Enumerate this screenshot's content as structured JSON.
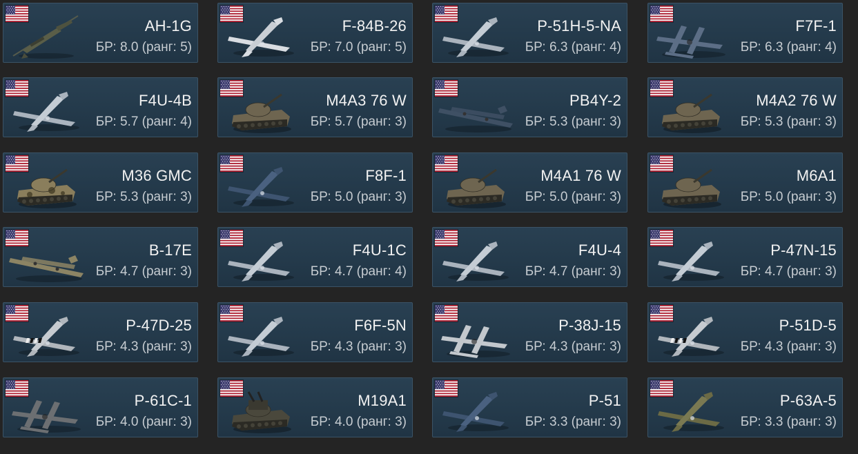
{
  "colors": {
    "background": "#242424",
    "card_bg": "#263d4e",
    "card_border": "#3b5366",
    "name_text": "#f2f2f2",
    "br_text": "#c6ccd1",
    "flag_red": "#b22234",
    "flag_blue": "#3c3b6e"
  },
  "vehicles": [
    {
      "name": "AH-1G",
      "br_line": "БР: 8.0 (ранг: 5)",
      "kind": "helicopter",
      "country": "USA",
      "flag_icon": "usa-flag-icon"
    },
    {
      "name": "F-84B-26",
      "br_line": "БР: 7.0 (ранг: 5)",
      "kind": "jet",
      "country": "USA",
      "flag_icon": "usa-flag-icon"
    },
    {
      "name": "P-51H-5-NA",
      "br_line": "БР: 6.3 (ранг: 4)",
      "kind": "plane",
      "country": "USA",
      "flag_icon": "usa-flag-icon"
    },
    {
      "name": "F7F-1",
      "br_line": "БР: 6.3 (ранг: 4)",
      "kind": "twin-plane-dark",
      "country": "USA",
      "flag_icon": "usa-flag-icon"
    },
    {
      "name": "F4U-4B",
      "br_line": "БР: 5.7 (ранг: 4)",
      "kind": "plane",
      "country": "USA",
      "flag_icon": "usa-flag-icon"
    },
    {
      "name": "M4A3 76 W",
      "br_line": "БР: 5.7 (ранг: 3)",
      "kind": "tank",
      "country": "USA",
      "flag_icon": "usa-flag-icon"
    },
    {
      "name": "PB4Y-2",
      "br_line": "БР: 5.3 (ранг: 3)",
      "kind": "bomber-dark",
      "country": "USA",
      "flag_icon": "usa-flag-icon"
    },
    {
      "name": "M4A2 76 W",
      "br_line": "БР: 5.3 (ранг: 3)",
      "kind": "tank",
      "country": "USA",
      "flag_icon": "usa-flag-icon"
    },
    {
      "name": "M36 GMC",
      "br_line": "БР: 5.3 (ранг: 3)",
      "kind": "tank-camo",
      "country": "USA",
      "flag_icon": "usa-flag-icon"
    },
    {
      "name": "F8F-1",
      "br_line": "БР: 5.0 (ранг: 3)",
      "kind": "plane-dark",
      "country": "USA",
      "flag_icon": "usa-flag-icon"
    },
    {
      "name": "M4A1 76 W",
      "br_line": "БР: 5.0 (ранг: 3)",
      "kind": "tank",
      "country": "USA",
      "flag_icon": "usa-flag-icon"
    },
    {
      "name": "M6A1",
      "br_line": "БР: 5.0 (ранг: 3)",
      "kind": "tank",
      "country": "USA",
      "flag_icon": "usa-flag-icon"
    },
    {
      "name": "B-17E",
      "br_line": "БР: 4.7 (ранг: 3)",
      "kind": "bomber",
      "country": "USA",
      "flag_icon": "usa-flag-icon"
    },
    {
      "name": "F4U-1C",
      "br_line": "БР: 4.7 (ранг: 4)",
      "kind": "plane",
      "country": "USA",
      "flag_icon": "usa-flag-icon"
    },
    {
      "name": "F4U-4",
      "br_line": "БР: 4.7 (ранг: 3)",
      "kind": "plane",
      "country": "USA",
      "flag_icon": "usa-flag-icon"
    },
    {
      "name": "P-47N-15",
      "br_line": "БР: 4.7 (ранг: 3)",
      "kind": "plane",
      "country": "USA",
      "flag_icon": "usa-flag-icon"
    },
    {
      "name": "P-47D-25",
      "br_line": "БР: 4.3 (ранг: 3)",
      "kind": "plane-stripes",
      "country": "USA",
      "flag_icon": "usa-flag-icon"
    },
    {
      "name": "F6F-5N",
      "br_line": "БР: 4.3 (ранг: 3)",
      "kind": "plane",
      "country": "USA",
      "flag_icon": "usa-flag-icon"
    },
    {
      "name": "P-38J-15",
      "br_line": "БР: 4.3 (ранг: 3)",
      "kind": "twin-boom",
      "country": "USA",
      "flag_icon": "usa-flag-icon"
    },
    {
      "name": "P-51D-5",
      "br_line": "БР: 4.3 (ранг: 3)",
      "kind": "plane-stripes",
      "country": "USA",
      "flag_icon": "usa-flag-icon"
    },
    {
      "name": "P-61C-1",
      "br_line": "БР: 4.0 (ранг: 3)",
      "kind": "twin-boom-dark",
      "country": "USA",
      "flag_icon": "usa-flag-icon"
    },
    {
      "name": "M19A1",
      "br_line": "БР: 4.0 (ранг: 3)",
      "kind": "tank-aa",
      "country": "USA",
      "flag_icon": "usa-flag-icon"
    },
    {
      "name": "P-51",
      "br_line": "БР: 3.3 (ранг: 3)",
      "kind": "plane-dark",
      "country": "USA",
      "flag_icon": "usa-flag-icon"
    },
    {
      "name": "P-63A-5",
      "br_line": "БР: 3.3 (ранг: 3)",
      "kind": "plane-olive",
      "country": "USA",
      "flag_icon": "usa-flag-icon"
    }
  ]
}
